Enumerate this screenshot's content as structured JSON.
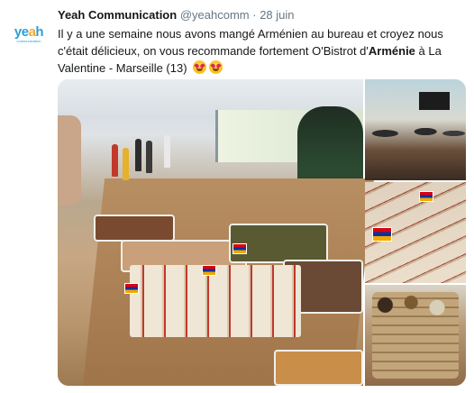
{
  "tweet": {
    "author_name": "Yeah Communication",
    "handle": "@yeahcomm",
    "separator": "·",
    "date": "28 juin",
    "text_part1": "Il y a une semaine nous avons mangé Arménien au bureau et croyez nous c'était délicieux, on vous recommande fortement O'Bistrot d'",
    "text_bold": "Arménie",
    "text_part2": " à La Valentine - Marseille (13)",
    "emojis": [
      "heart-eyes-emoji",
      "heart-eyes-emoji"
    ]
  },
  "avatar": {
    "brand_letters": [
      "y",
      "e",
      "a",
      "h"
    ],
    "tagline": "communication"
  },
  "media": {
    "photos": [
      {
        "name": "office-buffet-photo"
      },
      {
        "name": "office-team-photo"
      },
      {
        "name": "wraps-tray-photo"
      },
      {
        "name": "dishes-overhead-photo"
      }
    ]
  },
  "colors": {
    "brand_blue": "#2a9fd6",
    "brand_orange": "#f2a92b",
    "text": "#14171a",
    "secondary_text": "#657786",
    "flag": [
      "#d90012",
      "#0033a0",
      "#f2a800"
    ]
  }
}
